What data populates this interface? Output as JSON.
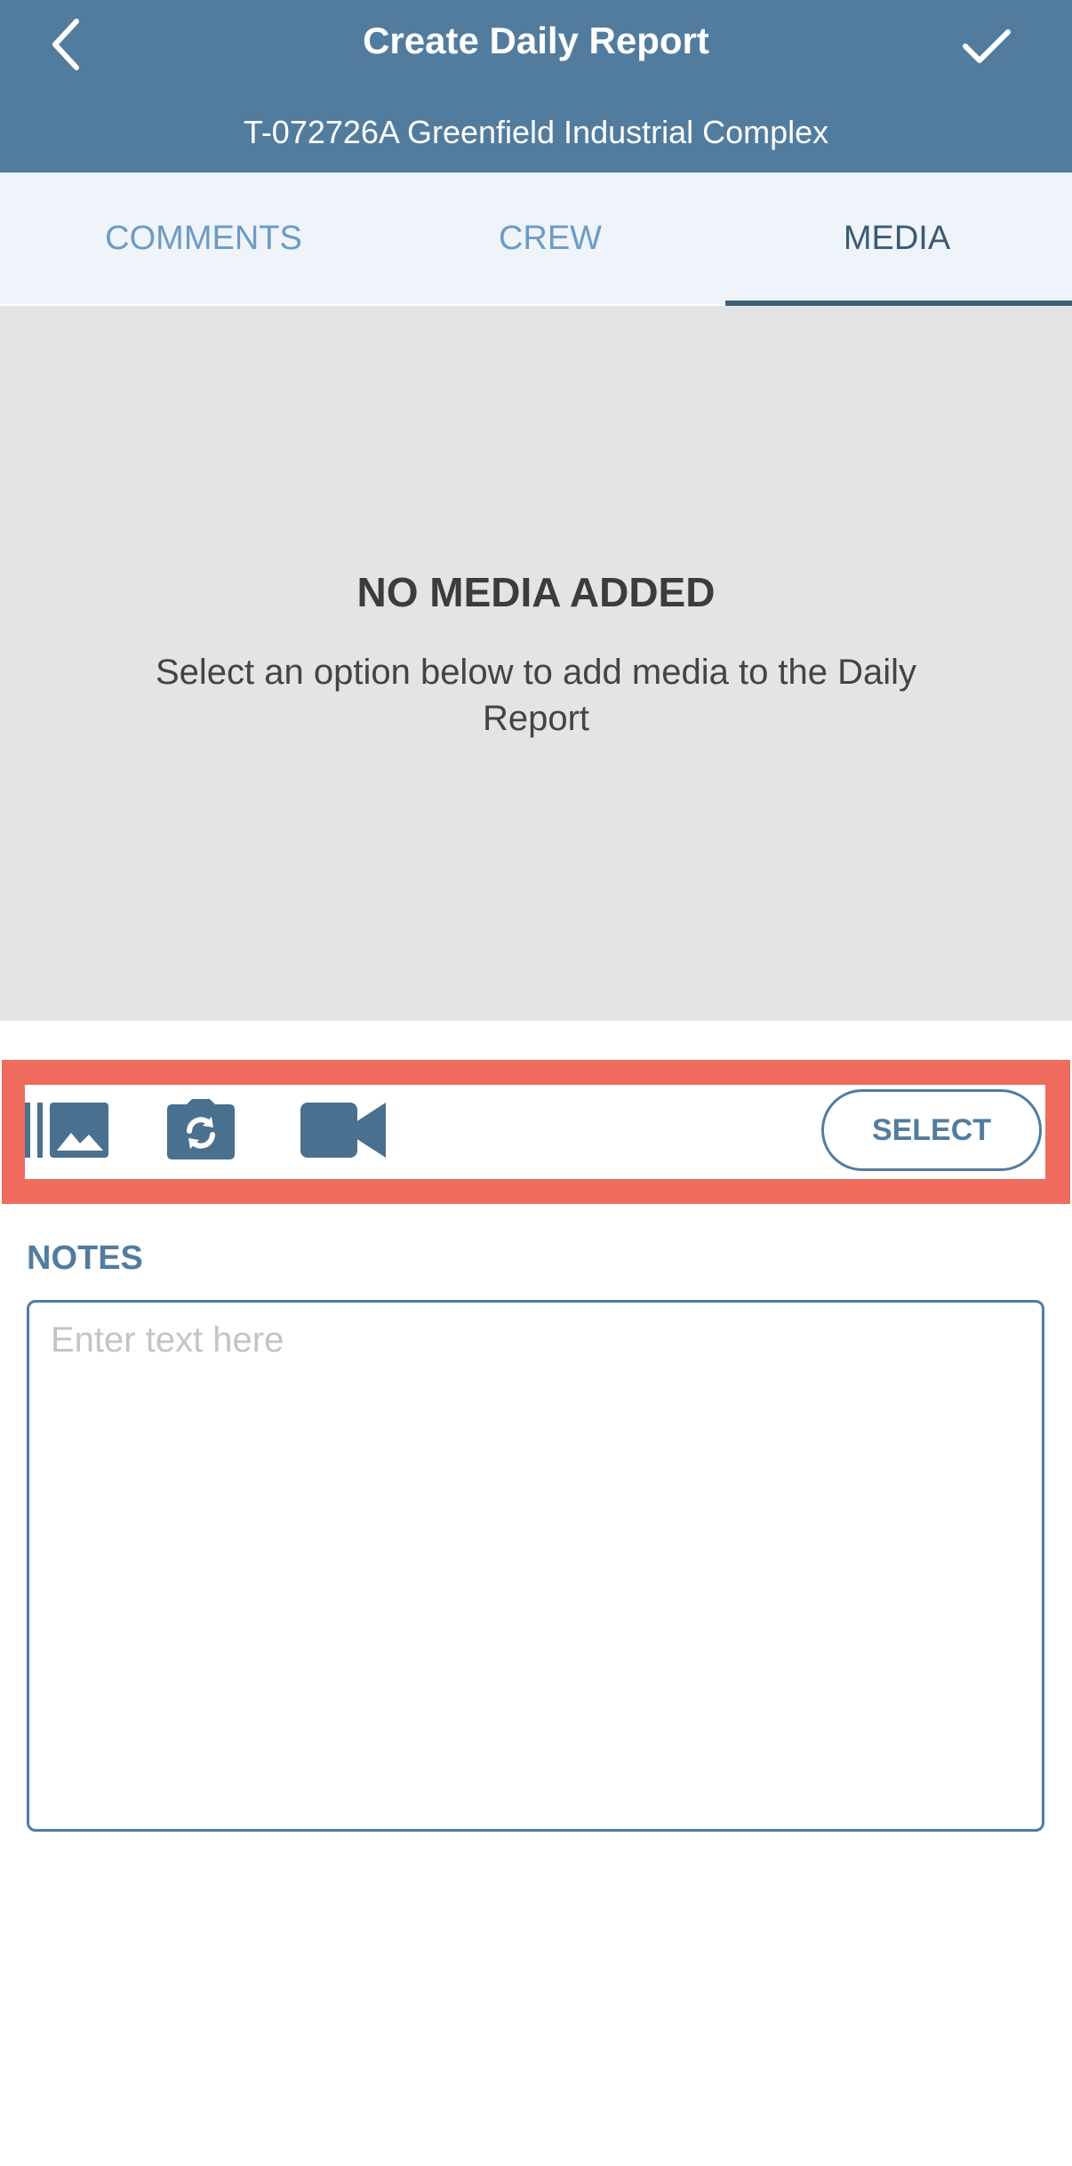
{
  "header": {
    "title": "Create Daily Report",
    "subtitle": "T-072726A Greenfield Industrial Complex",
    "back_icon": "chevron-left-icon",
    "confirm_icon": "checkmark-icon",
    "background_color": "#527c9e"
  },
  "tabs": [
    {
      "label": "COMMENTS",
      "active": false
    },
    {
      "label": "CREW",
      "active": false
    },
    {
      "label": "MEDIA",
      "active": true
    }
  ],
  "empty_state": {
    "title": "NO MEDIA ADDED",
    "message": "Select an option below to add media to the Daily Report"
  },
  "media_toolbar": {
    "icons": [
      "photo-gallery-icon",
      "camera-switch-icon",
      "video-camera-icon"
    ],
    "select_label": "SELECT",
    "highlight_color": "#ee6b5d"
  },
  "notes": {
    "label": "NOTES",
    "placeholder": "Enter text here",
    "value": ""
  }
}
